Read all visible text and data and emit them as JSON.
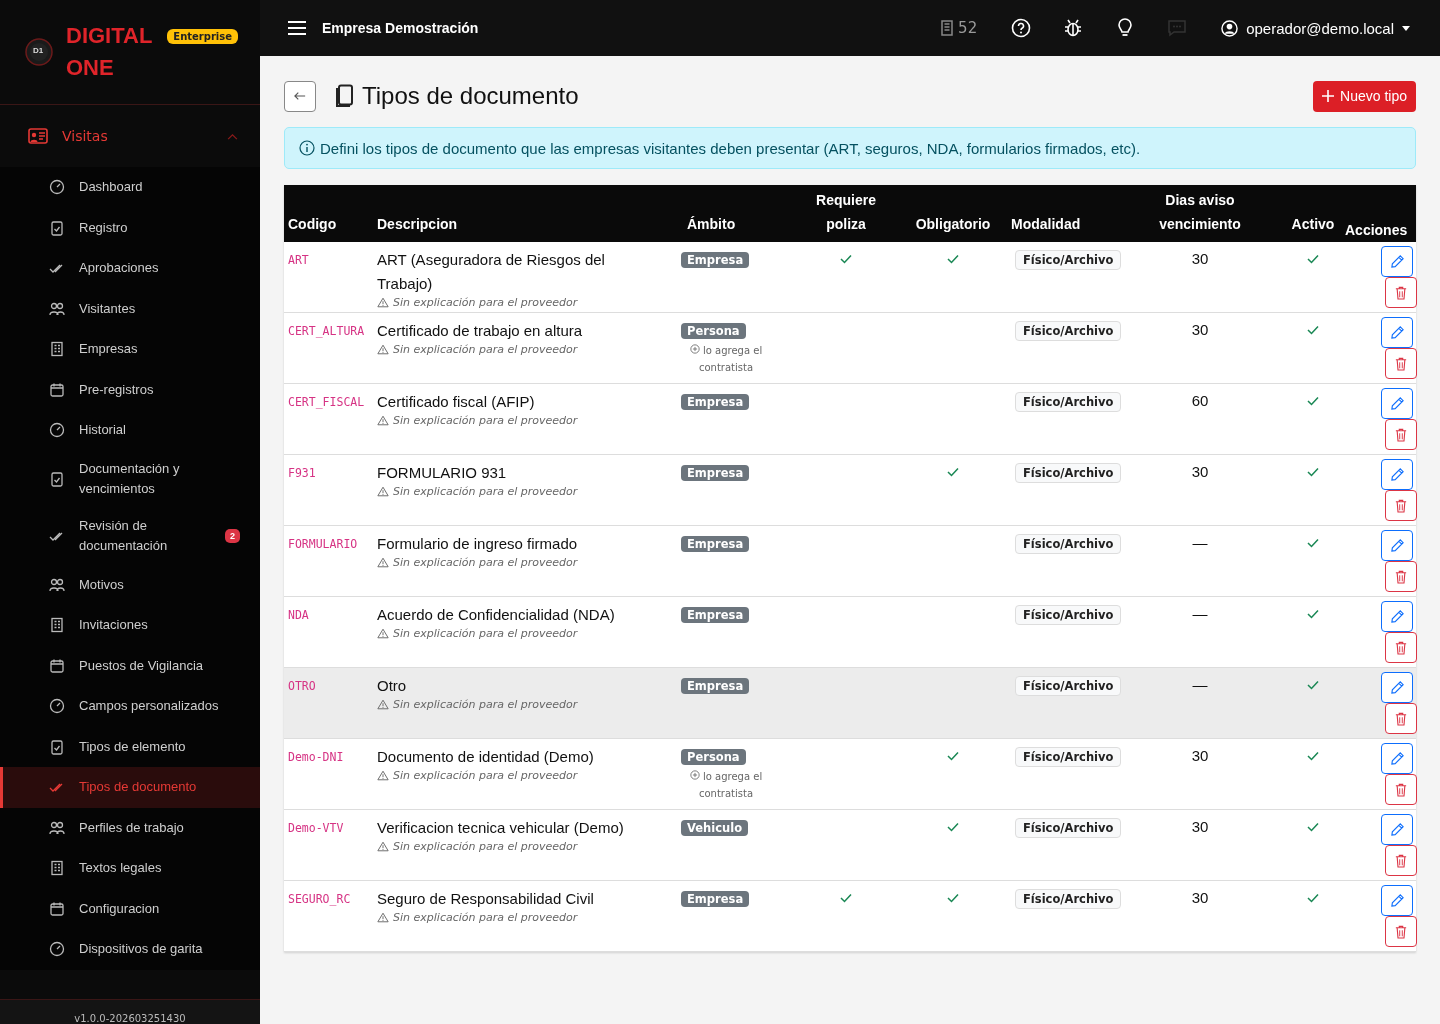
{
  "brand": {
    "logo_text": "D1",
    "name_line1": "DIGITAL",
    "name_line2": "ONE",
    "edition": "Enterprise"
  },
  "sidebar": {
    "section": {
      "label": "Visitas",
      "expanded": true
    },
    "items": [
      {
        "label": "Dashboard",
        "selected": false
      },
      {
        "label": "Registro",
        "selected": false
      },
      {
        "label": "Aprobaciones",
        "selected": false
      },
      {
        "label": "Visitantes",
        "selected": false
      },
      {
        "label": "Empresas",
        "selected": false
      },
      {
        "label": "Pre-registros",
        "selected": false
      },
      {
        "label": "Historial",
        "selected": false
      },
      {
        "label": "Documentación y vencimientos",
        "selected": false
      },
      {
        "label": "Revisión de documentación",
        "selected": false,
        "badge": "2"
      },
      {
        "label": "Motivos",
        "selected": false
      },
      {
        "label": "Invitaciones",
        "selected": false
      },
      {
        "label": "Puestos de Vigilancia",
        "selected": false
      },
      {
        "label": "Campos personalizados",
        "selected": false
      },
      {
        "label": "Tipos de elemento",
        "selected": false
      },
      {
        "label": "Tipos de documento",
        "selected": true
      },
      {
        "label": "Perfiles de trabajo",
        "selected": false
      },
      {
        "label": "Textos legales",
        "selected": false
      },
      {
        "label": "Configuracion",
        "selected": false
      },
      {
        "label": "Dispositivos de garita",
        "selected": false
      }
    ],
    "version": "v1.0.0-202603251430"
  },
  "topbar": {
    "company": "Empresa Demostración",
    "building_count": "52",
    "user": "operador@demo.local"
  },
  "page": {
    "title": "Tipos de documento",
    "new_button": "Nuevo tipo",
    "info": "Defini los tipos de documento que las empresas visitantes deben presentar (ART, seguros, NDA, formularios firmados, etc)."
  },
  "table": {
    "columns": [
      "Codigo",
      "Descripcion",
      "Ámbito",
      "Requiere poliza",
      "Obligatorio",
      "Modalidad",
      "Dias aviso vencimiento",
      "Activo",
      "Acciones"
    ],
    "rows": [
      {
        "code": "ART",
        "description": "ART (Aseguradora de Riesgos del Trabajo)",
        "note": "Sin explicación para el proveedor",
        "scope": "Empresa",
        "requires_policy": true,
        "mandatory": true,
        "modality": "Físico/Archivo",
        "notice_days": "30",
        "active": true,
        "highlighted": false
      },
      {
        "code": "CERT_ALTURA",
        "description": "Certificado de trabajo en altura",
        "note": "Sin explicación para el proveedor",
        "scope": "Persona",
        "scope_note": "lo agrega el contratista",
        "requires_policy": false,
        "mandatory": false,
        "modality": "Físico/Archivo",
        "notice_days": "30",
        "active": true,
        "highlighted": false
      },
      {
        "code": "CERT_FISCAL",
        "description": "Certificado fiscal (AFIP)",
        "note": "Sin explicación para el proveedor",
        "scope": "Empresa",
        "requires_policy": false,
        "mandatory": false,
        "modality": "Físico/Archivo",
        "notice_days": "60",
        "active": true,
        "highlighted": false
      },
      {
        "code": "F931",
        "description": "FORMULARIO 931",
        "note": "Sin explicación para el proveedor",
        "scope": "Empresa",
        "requires_policy": false,
        "mandatory": true,
        "modality": "Físico/Archivo",
        "notice_days": "30",
        "active": true,
        "highlighted": false
      },
      {
        "code": "FORMULARIO",
        "description": "Formulario de ingreso firmado",
        "note": "Sin explicación para el proveedor",
        "scope": "Empresa",
        "requires_policy": false,
        "mandatory": false,
        "modality": "Físico/Archivo",
        "notice_days": "—",
        "active": true,
        "highlighted": false
      },
      {
        "code": "NDA",
        "description": "Acuerdo de Confidencialidad (NDA)",
        "note": "Sin explicación para el proveedor",
        "scope": "Empresa",
        "requires_policy": false,
        "mandatory": false,
        "modality": "Físico/Archivo",
        "notice_days": "—",
        "active": true,
        "highlighted": false
      },
      {
        "code": "OTRO",
        "description": "Otro",
        "note": "Sin explicación para el proveedor",
        "scope": "Empresa",
        "requires_policy": false,
        "mandatory": false,
        "modality": "Físico/Archivo",
        "notice_days": "—",
        "active": true,
        "highlighted": true
      },
      {
        "code": "Demo-DNI",
        "description": "Documento de identidad (Demo)",
        "note": "Sin explicación para el proveedor",
        "scope": "Persona",
        "scope_note": "lo agrega el contratista",
        "requires_policy": false,
        "mandatory": true,
        "modality": "Físico/Archivo",
        "notice_days": "30",
        "active": true,
        "highlighted": false
      },
      {
        "code": "Demo-VTV",
        "description": "Verificacion tecnica vehicular (Demo)",
        "note": "Sin explicación para el proveedor",
        "scope": "Vehiculo",
        "requires_policy": false,
        "mandatory": true,
        "modality": "Físico/Archivo",
        "notice_days": "30",
        "active": true,
        "highlighted": false
      },
      {
        "code": "SEGURO_RC",
        "description": "Seguro de Responsabilidad Civil",
        "note": "Sin explicación para el proveedor",
        "scope": "Empresa",
        "requires_policy": true,
        "mandatory": true,
        "modality": "Físico/Archivo",
        "notice_days": "30",
        "active": true,
        "highlighted": false
      }
    ]
  }
}
